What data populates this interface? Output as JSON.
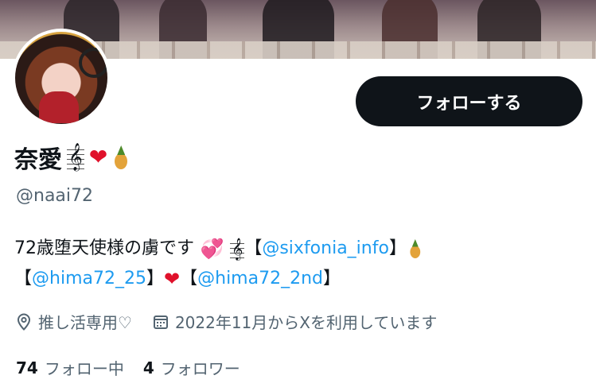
{
  "profile": {
    "display_name": "奈愛",
    "handle": "@naai72"
  },
  "actions": {
    "follow_label": "フォローする"
  },
  "bio": {
    "line1_text": "72歳堕天使様の虜です",
    "line1_link": "@sixfonia_info",
    "line2_link1": "@hima72_25",
    "line2_link2": "@hima72_2nd",
    "bracket_open": "【",
    "bracket_close": "】"
  },
  "meta": {
    "category": "推し活専用♡",
    "joined": "2022年11月からXを利用しています"
  },
  "stats": {
    "following_count": "74",
    "following_label": "フォロー中",
    "followers_count": "4",
    "followers_label": "フォロワー"
  },
  "icons": {
    "location": "location-pin-icon",
    "calendar": "calendar-icon"
  },
  "colors": {
    "link": "#1d9bf0",
    "button_bg": "#0f1419",
    "secondary_text": "#536471"
  }
}
